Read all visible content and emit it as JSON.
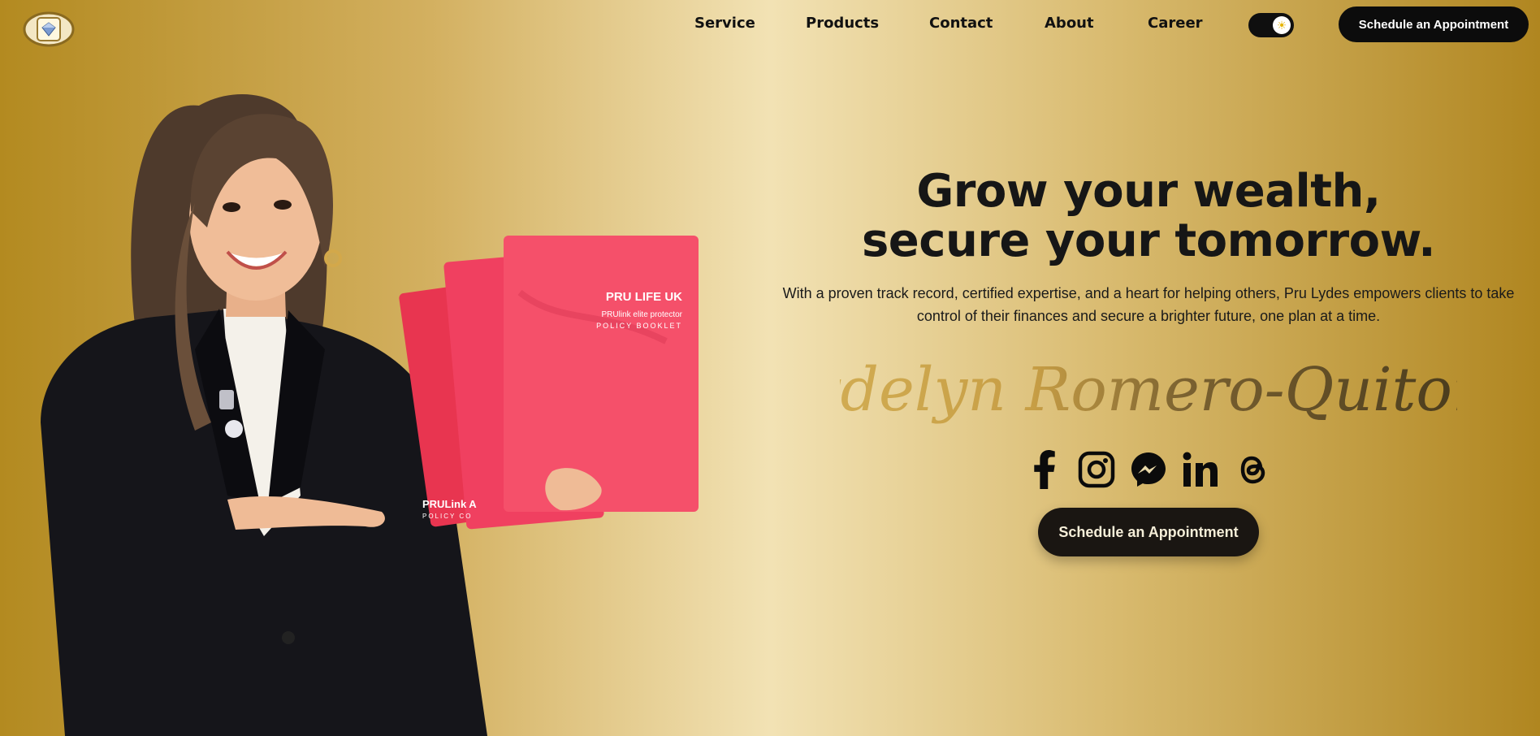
{
  "nav": {
    "items": [
      {
        "label": "Service",
        "key": "service"
      },
      {
        "label": "Products",
        "key": "products"
      },
      {
        "label": "Contact",
        "key": "contact"
      },
      {
        "label": "About",
        "key": "about"
      },
      {
        "label": "Career",
        "key": "career"
      }
    ],
    "cta_label": "Schedule an Appointment",
    "theme_toggle_icon": "sun-icon"
  },
  "hero": {
    "headline_line1": "Grow your wealth,",
    "headline_line2": "secure your tomorrow.",
    "subtext": "With a proven track record, certified expertise, and a heart for helping others, Pru Lydes empowers clients to take control of their finances and secure a brighter future, one plan at a time.",
    "signature_first": "Lydelyn",
    "signature_rest": "Romero-Quitong",
    "cta_label": "Schedule an Appointment",
    "socials": [
      "facebook-icon",
      "instagram-icon",
      "messenger-icon",
      "linkedin-icon",
      "threads-icon"
    ]
  },
  "booklets": {
    "brand": "PRU LIFE UK",
    "product": "PRUlink elite protector",
    "subtitle": "POLICY BOOKLET",
    "side_label": "PRULink A",
    "side_sub": "POLICY CO"
  },
  "colors": {
    "gold": "#c9a84c",
    "dark_gold": "#6b5520",
    "button_dark": "#0c0c0c",
    "booklet_red": "#f23a55"
  }
}
